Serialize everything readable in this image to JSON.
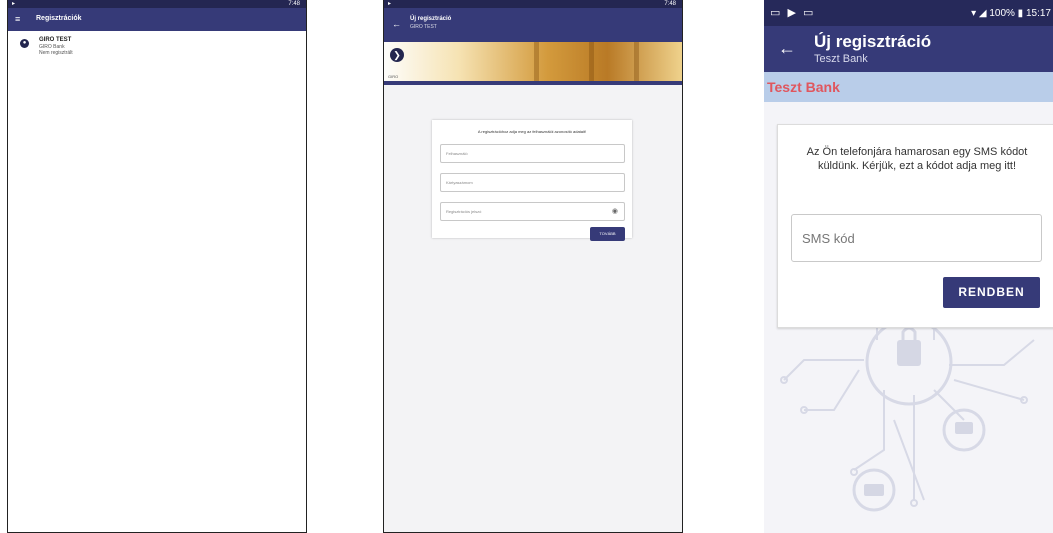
{
  "screen1": {
    "status_left": "▸",
    "status_right": "7:48",
    "menu_icon": "≡",
    "title": "Regisztrációk",
    "item": {
      "icon": "●",
      "name": "GIRO TEST",
      "line2": "GIRO Bank",
      "line3": "Nem regisztrált"
    }
  },
  "screen2": {
    "status_left": "▸",
    "status_right": "7:48",
    "back_icon": "←",
    "title": "Új regisztráció",
    "subtitle": "GIRO TEST",
    "logo_icon": "❯",
    "logo_caption": "GIRO",
    "message": "A regisztrációhoz adja meg az felhasználói azonosító adatait!",
    "field1_placeholder": "Felhasználó",
    "field2_placeholder": "Kártyaszámom",
    "field3_placeholder": "Regisztrációs jelszó",
    "eye_icon": "◉",
    "button": "TOVÁBB"
  },
  "screen3": {
    "status_left": "▭ ▶ ▭",
    "status_right": "▾ ◢ 100% ▮ 15:17",
    "back_icon": "←",
    "title": "Új regisztráció",
    "subtitle": "Teszt Bank",
    "bank_name": "Teszt Bank",
    "message": "Az Ön telefonjára hamarosan egy SMS kódot küldünk. Kérjük, ezt a kódot adja meg itt!",
    "input_placeholder": "SMS kód",
    "button": "RENDBEN"
  },
  "colors": {
    "appbar": "#363a78",
    "statusbar": "#26295a",
    "bankbar": "#b9cde9",
    "bankname": "#e0565e"
  }
}
